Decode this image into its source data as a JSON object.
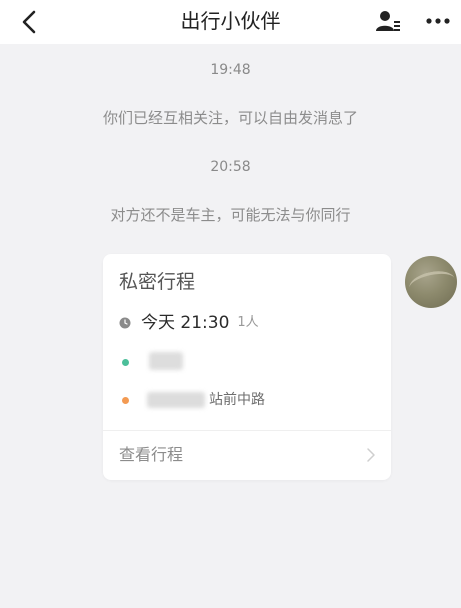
{
  "header": {
    "title": "出行小伙伴",
    "back_icon": "chevron-left-icon",
    "user_settings_icon": "user-settings-icon",
    "more_icon": "more-dots-icon"
  },
  "messages": [
    {
      "type": "time",
      "text": "19:48"
    },
    {
      "type": "system",
      "text": "你们已经互相关注，可以自由发消息了"
    },
    {
      "type": "time",
      "text": "20:58"
    },
    {
      "type": "system",
      "text": "对方还不是车主，可能无法与你同行"
    }
  ],
  "trip_card": {
    "title": "私密行程",
    "time_text": "今天 21:30",
    "passengers_text": "1人",
    "destination_suffix": "站前中路",
    "view_trip_label": "查看行程",
    "colors": {
      "start_dot": "#4cbf9a",
      "end_dot": "#f39a52"
    }
  },
  "colors": {
    "background": "#f2f2f4",
    "header": "#ffffff",
    "card": "#ffffff"
  }
}
